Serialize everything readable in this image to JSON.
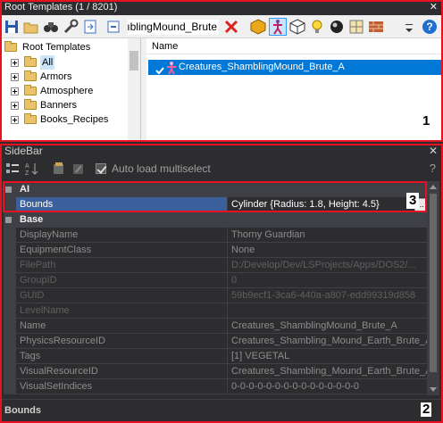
{
  "root_templates": {
    "title": "Root Templates (1 / 8201)",
    "close_glyph": "✕",
    "search_value": "ıblingMound_Brute",
    "tree": [
      {
        "label": "Root Templates",
        "icon": "folder-icon"
      },
      {
        "label": "All",
        "icon": "folder-icon"
      },
      {
        "label": "Armors",
        "icon": "folder-icon"
      },
      {
        "label": "Atmosphere",
        "icon": "folder-icon"
      },
      {
        "label": "Banners",
        "icon": "folder-icon"
      },
      {
        "label": "Books_Recipes",
        "icon": "folder-icon"
      }
    ],
    "list_header": "Name",
    "selected_item": "Creatures_ShamblingMound_Brute_A",
    "badge": "1"
  },
  "sidebar": {
    "title": "SideBar",
    "close_glyph": "✕",
    "auto_load_label": "Auto load multiselect",
    "help_glyph": "?",
    "categories": {
      "ai": "AI",
      "base": "Base"
    },
    "ai_rows": [
      {
        "key": "Bounds",
        "value": "Cylinder {Radius: 1.8, Height: 4.5}"
      }
    ],
    "base_rows": [
      {
        "key": "DisplayName",
        "value": "Thorny Guardian"
      },
      {
        "key": "EquipmentClass",
        "value": "None"
      },
      {
        "key": "FilePath",
        "value": "D:/Develop/Dev/LSProjects/Apps/DOS2/..."
      },
      {
        "key": "GroupID",
        "value": "0"
      },
      {
        "key": "GUID",
        "value": "59b9ecf1-3ca6-440a-a807-edd99319d858"
      },
      {
        "key": "LevelName",
        "value": ""
      },
      {
        "key": "Name",
        "value": "Creatures_ShamblingMound_Brute_A"
      },
      {
        "key": "PhysicsResourceID",
        "value": "Creatures_Shambling_Mound_Earth_Brute_A"
      },
      {
        "key": "Tags",
        "value": "[1] VEGETAL"
      },
      {
        "key": "VisualResourceID",
        "value": "Creatures_Shambling_Mound_Earth_Brute_A"
      },
      {
        "key": "VisualSetIndices",
        "value": "0-0-0-0-0-0-0-0-0-0-0-0-0-0-0"
      }
    ],
    "description_title": "Bounds",
    "ellipsis": "...",
    "badge_2": "2",
    "badge_3": "3"
  },
  "colors": {
    "highlight_red": "#e81123",
    "selection_blue": "#0078d7",
    "panel_dark": "#2d2d30"
  }
}
